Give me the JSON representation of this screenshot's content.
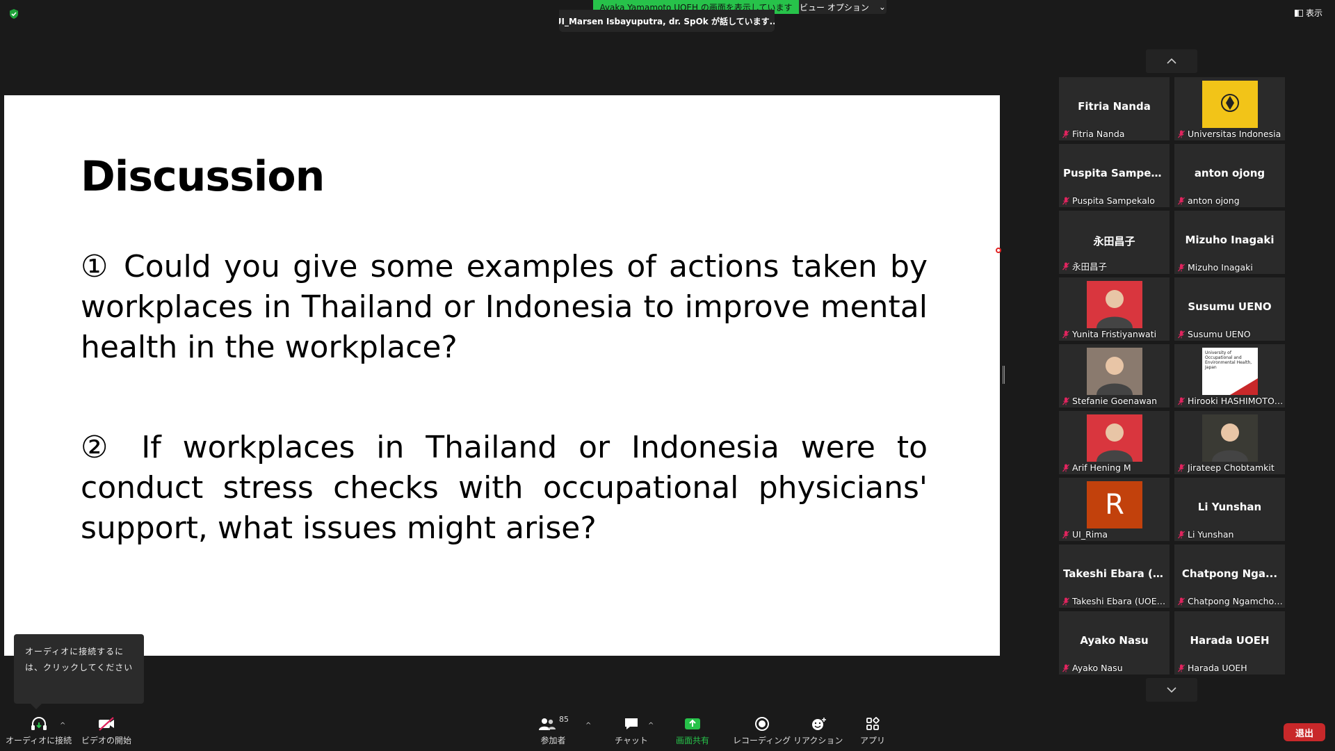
{
  "top": {
    "share_banner": "Ayaka Yamamoto UOEH の画面を表示しています",
    "view_options": "ビュー オプション",
    "speaking": "UI_Marsen Isbayuputra, dr. SpOk が話しています...",
    "view_button": "表示"
  },
  "slide": {
    "title": "Discussion",
    "q1": "① Could you give some examples of actions taken by workplaces in Thailand or Indonesia to improve mental health in the workplace?",
    "q2": "② If workplaces in Thailand or Indonesia were to conduct stress checks with occupational physicians' support, what issues might arise?"
  },
  "audio_tip": "オーディオに接続するには、クリックしてください",
  "participants": [
    {
      "big": "Fitria Nanda",
      "label": "Fitria Nanda",
      "kind": "name"
    },
    {
      "big": "",
      "label": "Universitas Indonesia",
      "kind": "ui-logo"
    },
    {
      "big": "Puspita Sampek...",
      "label": "Puspita Sampekalo",
      "kind": "name"
    },
    {
      "big": "anton ojong",
      "label": "anton ojong",
      "kind": "name"
    },
    {
      "big": "永田昌子",
      "label": "永田昌子",
      "kind": "name"
    },
    {
      "big": "Mizuho Inagaki",
      "label": "Mizuho Inagaki",
      "kind": "name"
    },
    {
      "big": "",
      "label": "Yunita Fristiyanwati",
      "kind": "photo"
    },
    {
      "big": "Susumu UENO",
      "label": "Susumu UENO",
      "kind": "name"
    },
    {
      "big": "",
      "label": "Stefanie Goenawan",
      "kind": "photo"
    },
    {
      "big": "",
      "label": "Hirooki HASHIMOTO,...",
      "kind": "uoeh-logo"
    },
    {
      "big": "",
      "label": "Arif Hening M",
      "kind": "photo"
    },
    {
      "big": "",
      "label": "Jirateep Chobtamkit",
      "kind": "photo"
    },
    {
      "big": "R",
      "label": "UI_Rima",
      "kind": "initial"
    },
    {
      "big": "Li Yunshan",
      "label": "Li Yunshan",
      "kind": "name"
    },
    {
      "big": "Takeshi Ebara (U...",
      "label": "Takeshi Ebara (UOEH,...",
      "kind": "name"
    },
    {
      "big": "Chatpong Nga...",
      "label": "Chatpong Ngamchok...",
      "kind": "name"
    },
    {
      "big": "Ayako Nasu",
      "label": "Ayako Nasu",
      "kind": "name"
    },
    {
      "big": "Harada UOEH",
      "label": "Harada UOEH",
      "kind": "name"
    }
  ],
  "uoeh_logo_text": "University of Occupational and Environmental Health, Japan",
  "toolbar": {
    "audio": "オーディオに接続",
    "video": "ビデオの開始",
    "participants": "参加者",
    "participants_count": "85",
    "chat": "チャット",
    "share": "画面共有",
    "record": "レコーディング",
    "reaction": "リアクション",
    "apps": "アプリ",
    "leave": "退出"
  },
  "colors": {
    "banner": "#27c24a",
    "leave": "#c8282a",
    "muted_mic": "#e0245e",
    "share_icon": "#27c24a"
  }
}
